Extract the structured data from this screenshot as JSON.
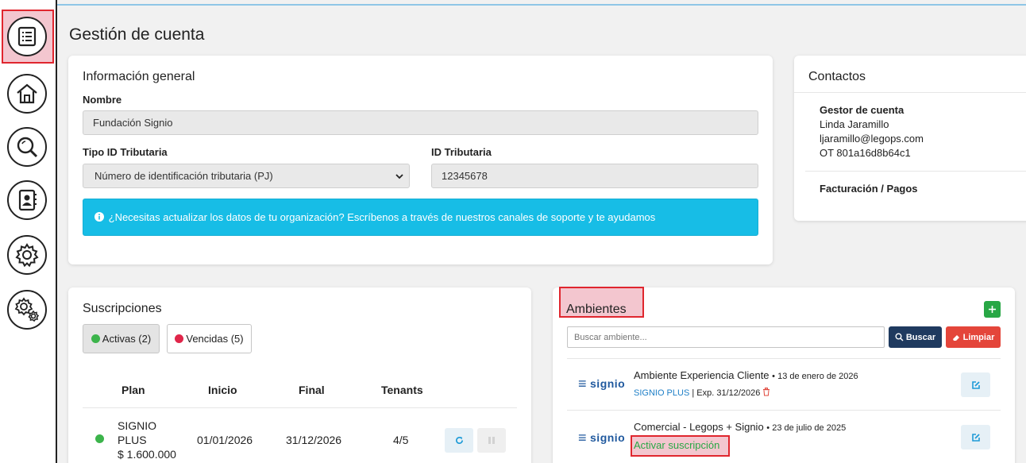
{
  "page_title": "Gestión de cuenta",
  "info_general": {
    "title": "Información general",
    "nombre_label": "Nombre",
    "nombre_value": "Fundación Signio",
    "tipo_id_label": "Tipo ID Tributaria",
    "tipo_id_value": "Número de identificación tributaria (PJ)",
    "id_label": "ID Tributaria",
    "id_value": "12345678",
    "alert": "¿Necesitas actualizar los datos de tu organización? Escríbenos a través de nuestros canales de soporte y te ayudamos"
  },
  "contactos": {
    "title": "Contactos",
    "gestor_label": "Gestor de cuenta",
    "gestor_name": "Linda Jaramillo",
    "gestor_email": "ljaramillo@legops.com",
    "gestor_ot": "OT 801a16d8b64c1",
    "facturacion_label": "Facturación / Pagos"
  },
  "suscripciones": {
    "title": "Suscripciones",
    "tab_activas": "Activas (2)",
    "tab_vencidas": "Vencidas (5)",
    "columns": [
      "Plan",
      "Inicio",
      "Final",
      "Tenants"
    ],
    "rows": [
      {
        "plan_line1": "SIGNIO",
        "plan_line2": "PLUS",
        "price": "$ 1.600.000",
        "inicio": "01/01/2026",
        "final": "31/12/2026",
        "tenants": "4/5"
      }
    ]
  },
  "ambientes": {
    "title": "Ambientes",
    "search_placeholder": "Buscar ambiente...",
    "buscar_label": "Buscar",
    "limpiar_label": "Limpiar",
    "logo_text": "signio",
    "items": [
      {
        "name": "Ambiente Experiencia Cliente",
        "date": "13 de enero de 2026",
        "plan": "SIGNIO PLUS",
        "exp": "| Exp. 31/12/2026"
      },
      {
        "name": "Comercial - Legops + Signio",
        "date": "23 de julio de 2025",
        "action": "Activar suscripción"
      }
    ]
  },
  "colors": {
    "accent_blue": "#17bde6",
    "buscar_bg": "#1f3a5f",
    "limpiar_bg": "#e4453a",
    "add_green": "#28a745",
    "highlight_red": "#e0262e"
  },
  "icons": {
    "sidebar": [
      "list-icon",
      "home-icon",
      "search-icon",
      "contacts-icon",
      "settings-icon",
      "advanced-settings-icon"
    ]
  }
}
